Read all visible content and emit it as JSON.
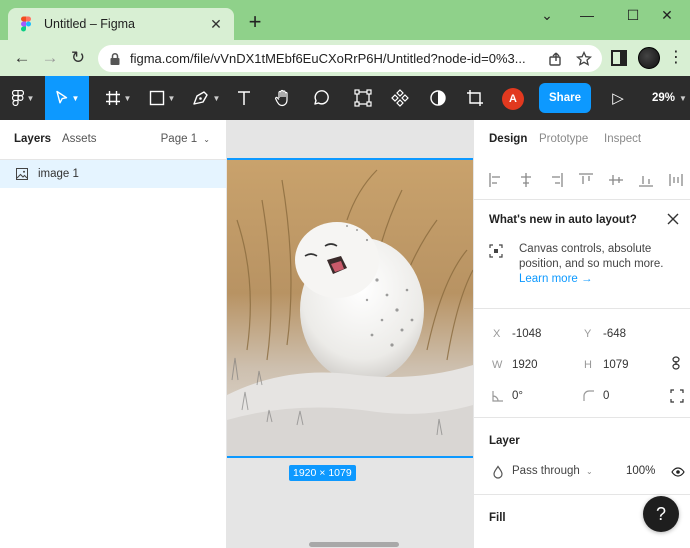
{
  "browser": {
    "tab_title": "Untitled – Figma",
    "tab_close": "✕",
    "new_tab": "+",
    "window_controls": {
      "collapse": "⌄",
      "minimize": "—",
      "maximize": "☐",
      "close": "✕"
    },
    "url": "figma.com/file/vVnDX1tMEbf6EuCXoRrP6H/Untitled?node-id=0%3...",
    "back": "←",
    "forward": "→",
    "reload": "↻",
    "menu": "⋮"
  },
  "toolbar": {
    "share_label": "Share",
    "zoom": "29%",
    "avatar_initial": "A",
    "play": "▷"
  },
  "left_panel": {
    "tabs": [
      "Layers",
      "Assets"
    ],
    "page": "Page 1",
    "layers": [
      {
        "name": "image 1"
      }
    ]
  },
  "canvas": {
    "dimension_badge": "1920 × 1079"
  },
  "right_panel": {
    "tabs": [
      "Design",
      "Prototype",
      "Inspect"
    ],
    "whats_new": {
      "title": "What's new in auto layout?",
      "body": "Canvas controls, absolute position, and so much more.",
      "link": "Learn more →"
    },
    "props": {
      "x_label": "X",
      "x_value": "-1048",
      "y_label": "Y",
      "y_value": "-648",
      "w_label": "W",
      "w_value": "1920",
      "h_label": "H",
      "h_value": "1079",
      "rotation": "0°",
      "radius": "0"
    },
    "layer": {
      "title": "Layer",
      "blend_mode": "Pass through",
      "opacity": "100%"
    },
    "fill": {
      "title": "Fill"
    }
  },
  "help_label": "?"
}
